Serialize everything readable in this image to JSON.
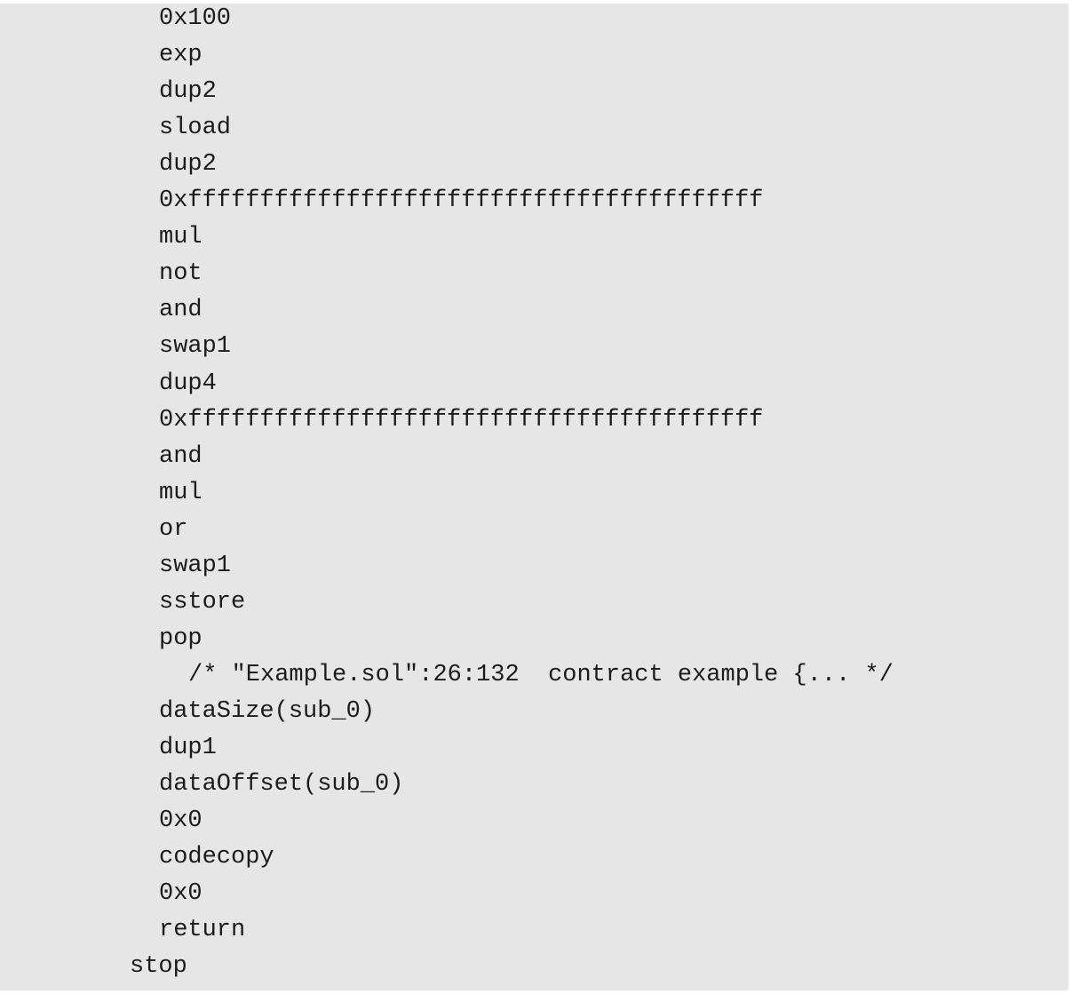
{
  "document": {
    "code_lines": [
      {
        "text": "0x100",
        "indent": 1
      },
      {
        "text": "exp",
        "indent": 1
      },
      {
        "text": "dup2",
        "indent": 1
      },
      {
        "text": "sload",
        "indent": 1
      },
      {
        "text": "dup2",
        "indent": 1
      },
      {
        "text": "0xffffffffffffffffffffffffffffffffffffffff",
        "indent": 1
      },
      {
        "text": "mul",
        "indent": 1
      },
      {
        "text": "not",
        "indent": 1
      },
      {
        "text": "and",
        "indent": 1
      },
      {
        "text": "swap1",
        "indent": 1
      },
      {
        "text": "dup4",
        "indent": 1
      },
      {
        "text": "0xffffffffffffffffffffffffffffffffffffffff",
        "indent": 1
      },
      {
        "text": "and",
        "indent": 1
      },
      {
        "text": "mul",
        "indent": 1
      },
      {
        "text": "or",
        "indent": 1
      },
      {
        "text": "swap1",
        "indent": 1
      },
      {
        "text": "sstore",
        "indent": 1
      },
      {
        "text": "pop",
        "indent": 1
      },
      {
        "text": "/* \"Example.sol\":26:132  contract example {... */",
        "indent": 2
      },
      {
        "text": "dataSize(sub_0)",
        "indent": 1
      },
      {
        "text": "dup1",
        "indent": 1
      },
      {
        "text": "dataOffset(sub_0)",
        "indent": 1
      },
      {
        "text": "0x0",
        "indent": 1
      },
      {
        "text": "codecopy",
        "indent": 1
      },
      {
        "text": "0x0",
        "indent": 1
      },
      {
        "text": "return",
        "indent": 1
      },
      {
        "text": "stop",
        "indent": 0
      }
    ]
  },
  "colors": {
    "background": "#e6e6e6",
    "text": "#1c1c1c"
  }
}
